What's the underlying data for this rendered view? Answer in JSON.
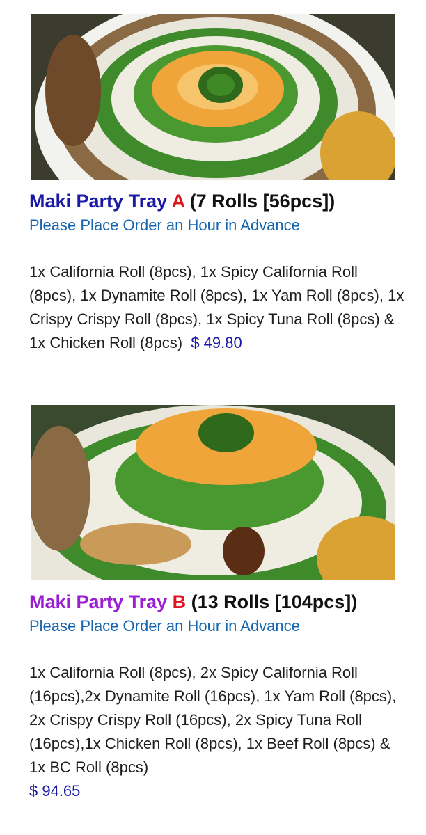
{
  "products": [
    {
      "tray_name": "Maki Party Tray",
      "tray_letter": "A",
      "tray_count": "(7 Rolls [56pcs])",
      "notice": "Please Place Order an Hour in Advance",
      "description": "1x California Roll (8pcs), 1x Spicy California Roll (8pcs), 1x Dynamite Roll (8pcs), 1x Yam Roll (8pcs), 1x Crispy Crispy Roll (8pcs), 1x Spicy Tuna Roll (8pcs) &  1x Chicken Roll (8pcs)",
      "price": "$ 49.80",
      "name_color": "#1a1aa6"
    },
    {
      "tray_name": "Maki Party Tray",
      "tray_letter": "B",
      "tray_count": "(13 Rolls [104pcs])",
      "notice": "Please Place Order an Hour in Advance",
      "description": "1x California Roll (8pcs), 2x Spicy California Roll (16pcs),2x Dynamite Roll (16pcs), 1x Yam Roll (8pcs), 2x Crispy Crispy Roll (16pcs), 2x Spicy Tuna Roll (16pcs),1x Chicken Roll (8pcs), 1x Beef Roll (8pcs) & 1x BC Roll (8pcs)",
      "price": "$ 94.65",
      "name_color": "#9b1fd1"
    }
  ],
  "colors": {
    "accent_letter": "#e0141e",
    "notice": "#1565b0",
    "price": "#1a1aa6"
  }
}
